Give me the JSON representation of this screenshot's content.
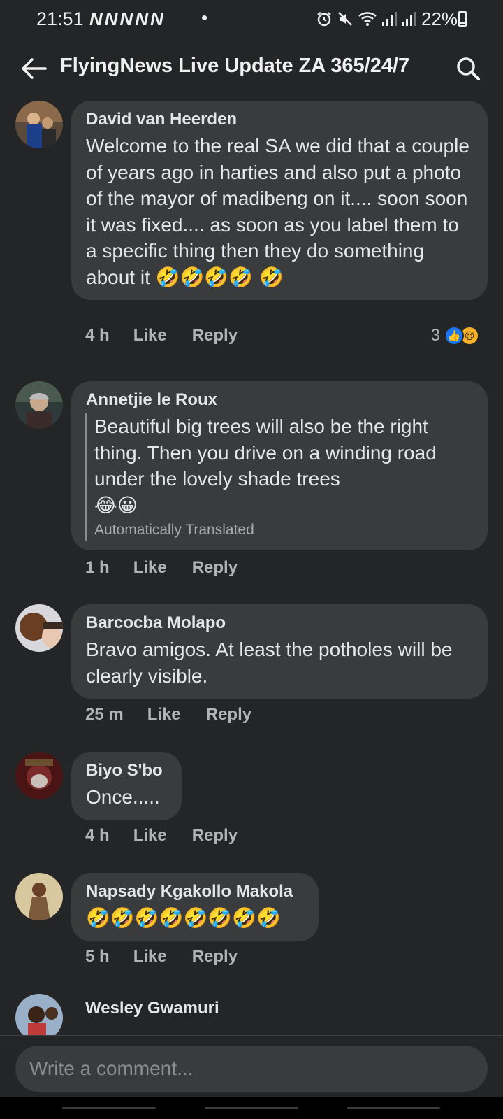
{
  "status_bar": {
    "time": "21:51",
    "notification_icons": "NNNNN",
    "dot": "•",
    "battery": "22%"
  },
  "header": {
    "title": "FlyingNews Live Update ZA 365/24/7",
    "back_icon": "arrow-left-icon",
    "search_icon": "search-icon"
  },
  "comments": [
    {
      "author": "David van Heerden",
      "text": "Welcome to the real SA we did that a couple of years ago in harties and also put a photo of the mayor of madibeng on it.... soon soon it was fixed.... as soon as you label them to a specific thing then they do something about it",
      "emoji": "🤣🤣🤣🤣 🤣",
      "time": "4 h",
      "like_label": "Like",
      "reply_label": "Reply",
      "reaction_count": "3"
    },
    {
      "author": "Annetjie le Roux",
      "text": "Beautiful big trees will also be the right thing. Then you drive on a winding road under the lovely shade trees",
      "emoji": "😂😀",
      "translated_label": "Automatically Translated",
      "time": "1 h",
      "like_label": "Like",
      "reply_label": "Reply"
    },
    {
      "author": "Barcocba Molapo",
      "text": "Bravo amigos. At least the potholes will be clearly visible.",
      "time": "25 m",
      "like_label": "Like",
      "reply_label": "Reply"
    },
    {
      "author": "Biyo S'bo",
      "text": "Once.....",
      "time": "4 h",
      "like_label": "Like",
      "reply_label": "Reply"
    },
    {
      "author": "Napsady Kgakollo Makola",
      "emoji": "🤣🤣🤣🤣🤣🤣🤣🤣",
      "time": "5 h",
      "like_label": "Like",
      "reply_label": "Reply"
    },
    {
      "author": "Wesley Gwamuri"
    }
  ],
  "comment_input": {
    "placeholder": "Write a comment..."
  },
  "colors": {
    "background": "#242526",
    "bubble": "#3a3b3c",
    "text": "#e4e6eb",
    "secondary_text": "#b0b3b8",
    "like_blue": "#1877f2",
    "haha_yellow": "#f7b125"
  }
}
